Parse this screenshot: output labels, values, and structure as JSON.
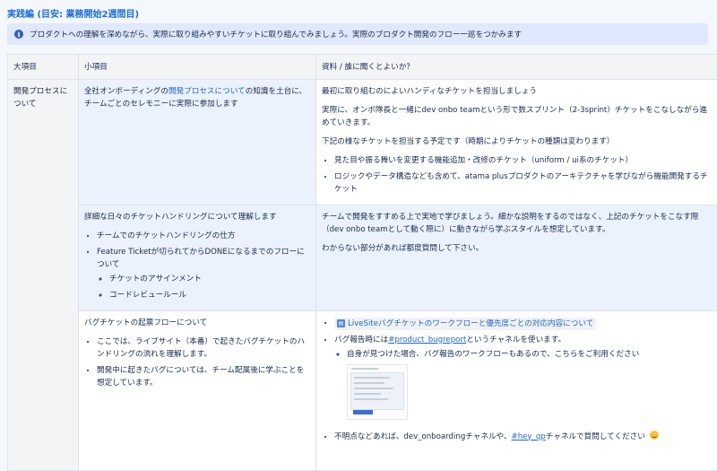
{
  "page": {
    "title": "実践編 (目安: 業務開始2週間目)"
  },
  "info": {
    "icon": "info-icon",
    "text": "プロダクトへの理解を深めながら、実際に取り組みやすいチケットに取り組んでみましょう。実際のプロダクト開発のフロー一巡をつかみます"
  },
  "table": {
    "headers": [
      "大項目",
      "小項目",
      "資料 / 誰に聞くとよいか？"
    ],
    "category": "開発プロセスについて",
    "row1": {
      "item_pre": "全社オンボーディングの",
      "item_link": "開発プロセスについて",
      "item_post": "の知識を土台に、チームごとのセレモニーに実際に参加します",
      "res_p1": "最初に取り組むのによいハンディなチケットを担当しましょう",
      "res_p2": "実際に、オンボ隊長と一緒にdev onbo teamという形で数スプリント（2-3sprint）チケットをこなしながら進めていきます。",
      "res_p3": "下記の様なチケットを担当する予定です（時期によりチケットの種類は変わります）",
      "res_b1": "見た目や振る舞いを変更する機能追加・改修のチケット（uniform / ui系のチケット）",
      "res_b2": "ロジックやデータ構造なども含めて、atama plusプロダクトのアーキテクチャを学びながら機能開発するチケット"
    },
    "row2": {
      "item_p": "詳細な日々のチケットハンドリングについて理解します",
      "item_b1": "チームでのチケットハンドリングの仕方",
      "item_b2": "Feature Ticketが切られてからDONEになるまでのフローについて",
      "item_s1": "チケットのアサインメント",
      "item_s2": "コードレビュールール",
      "res_p1": "チームで開発をすすめる上で実地で学びましょう。細かな説明をするのではなく、上記のチケットをこなす際（dev onbo teamとして動く際に）に動きながら学ぶスタイルを想定しています。",
      "res_p2": "わからない部分があれば都度質問して下さい。"
    },
    "row3": {
      "item_p": "バグチケットの起票フローについて",
      "item_b1": "ここでは、ライブサイト（本番）で起きたバグチケットのハンドリングの流れを理解します。",
      "item_b2": "開発中に起きたバグについては、チーム配属後に学ぶことを想定しています。",
      "res_link": "LiveSiteバグチケットのワークフローと優先度ごとの対応内容について",
      "res_b2_pre": "バグ報告時には",
      "res_b2_tag": "#product_bugreport",
      "res_b2_post": "というチャネルを使います。",
      "res_s1": "自身が見つけた場合、バグ報告のワークフローもあるので、こちらをご利用ください",
      "res_b3_pre": "不明点などあれば、dev_onboardingチャネルや、",
      "res_b3_tag": "#hey_qp",
      "res_b3_post": "チャネルで質問してください"
    }
  }
}
